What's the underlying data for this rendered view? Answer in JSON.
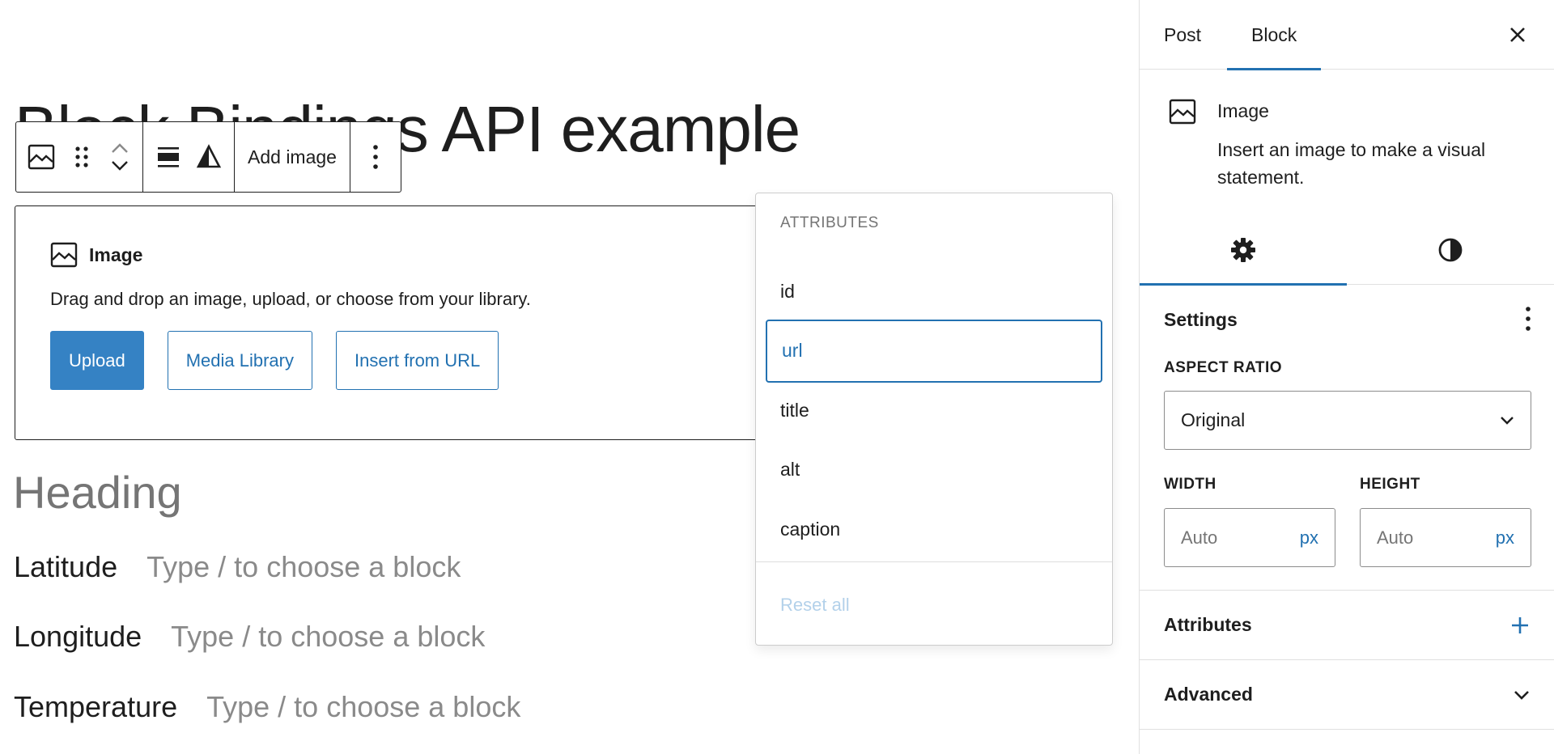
{
  "editor": {
    "post_title": "Block Bindings API example",
    "toolbar": {
      "block_type_icon": "image-icon",
      "drag_icon": "drag-handle-icon",
      "move_up_icon": "chevron-up-icon",
      "move_down_icon": "chevron-down-icon",
      "align_icon": "align-none-icon",
      "duotone_icon": "duotone-icon",
      "add_image_label": "Add image",
      "more_icon": "more-vertical-icon"
    },
    "image_placeholder": {
      "label": "Image",
      "instructions": "Drag and drop an image, upload, or choose from your library.",
      "upload_label": "Upload",
      "media_library_label": "Media Library",
      "insert_url_label": "Insert from URL"
    },
    "heading_placeholder": "Heading",
    "paragraphs": [
      {
        "label": "Latitude",
        "placeholder": "Type / to choose a block"
      },
      {
        "label": "Longitude",
        "placeholder": "Type / to choose a block"
      },
      {
        "label": "Temperature",
        "placeholder": "Type / to choose a block"
      }
    ]
  },
  "attributes_dropdown": {
    "heading": "ATTRIBUTES",
    "items": [
      "id",
      "url",
      "title",
      "alt",
      "caption"
    ],
    "selected": "url",
    "reset_label": "Reset all"
  },
  "sidebar": {
    "tabs": [
      {
        "label": "Post",
        "active": false
      },
      {
        "label": "Block",
        "active": true
      }
    ],
    "close_icon": "close-icon",
    "block_card": {
      "title": "Image",
      "description": "Insert an image to make a visual statement."
    },
    "style_tabs": [
      {
        "icon": "gear-icon",
        "active": true
      },
      {
        "icon": "contrast-icon",
        "active": false
      }
    ],
    "settings": {
      "title": "Settings",
      "aspect_ratio_label": "ASPECT RATIO",
      "aspect_ratio_value": "Original",
      "width_label": "WIDTH",
      "height_label": "HEIGHT",
      "width_placeholder": "Auto",
      "height_placeholder": "Auto",
      "unit": "px"
    },
    "attributes_panel": {
      "title": "Attributes"
    },
    "advanced_panel": {
      "title": "Advanced"
    }
  },
  "colors": {
    "accent": "#2271b1",
    "primary_button": "#3582c4",
    "text": "#1e1e1e",
    "muted": "#757575"
  }
}
